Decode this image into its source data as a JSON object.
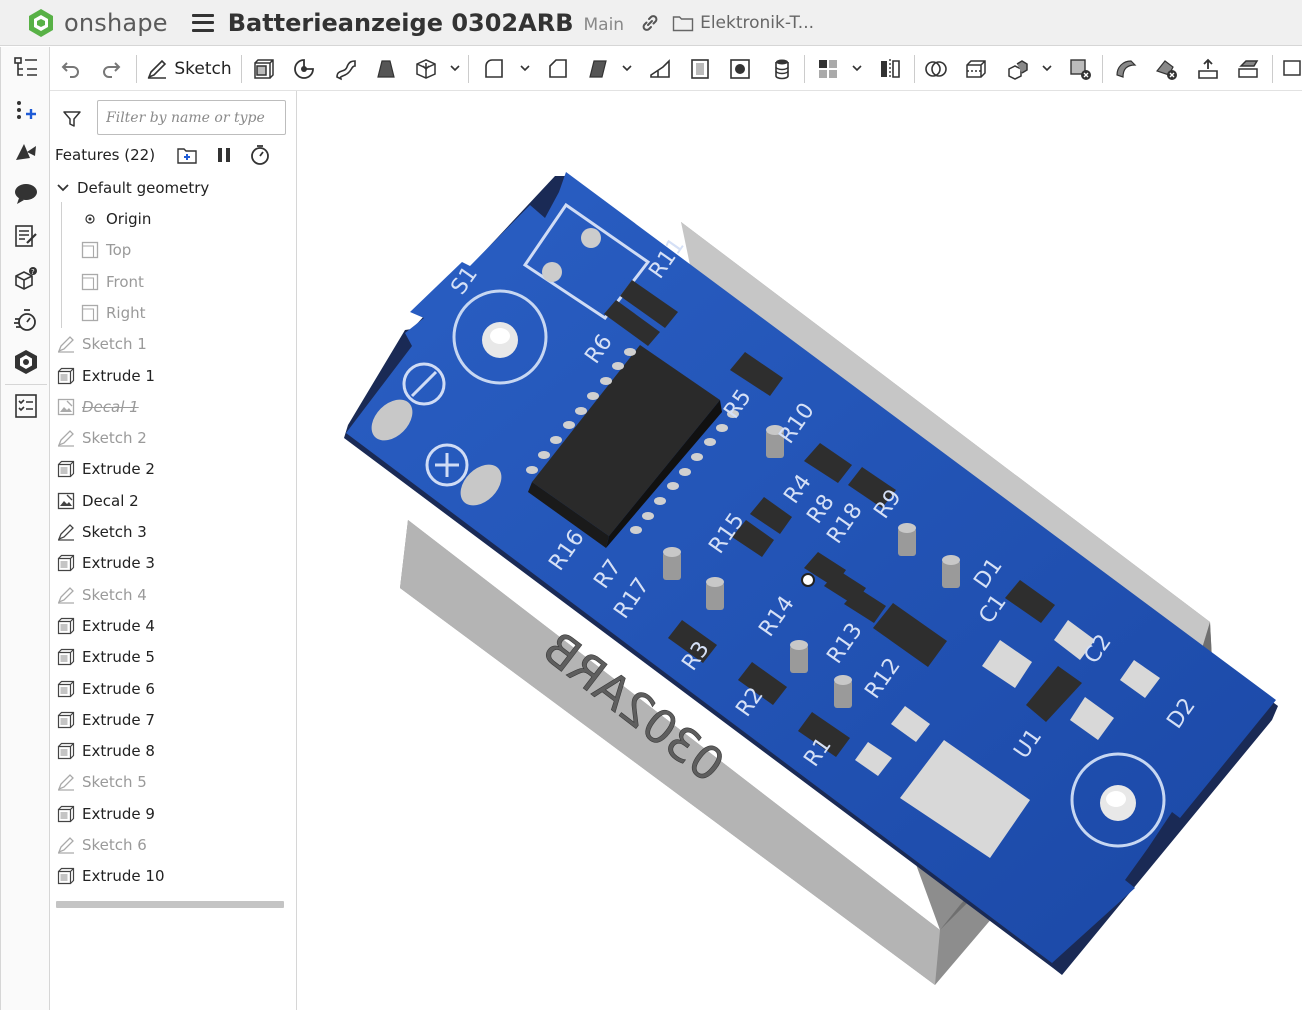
{
  "header": {
    "brand": "onshape",
    "document_title": "Batterieanzeige 0302ARB",
    "branch": "Main",
    "folder_name": "Elektronik-T..."
  },
  "toolbar": {
    "sketch_label": "Sketch"
  },
  "panel": {
    "filter_placeholder": "Filter by name or type",
    "features_title": "Features (22)",
    "default_geometry": "Default geometry",
    "items": [
      {
        "label": "Origin",
        "icon": "origin-icon",
        "state": "normal",
        "indent": 2
      },
      {
        "label": "Top",
        "icon": "plane-icon",
        "state": "dim",
        "indent": 2
      },
      {
        "label": "Front",
        "icon": "plane-icon",
        "state": "dim",
        "indent": 2
      },
      {
        "label": "Right",
        "icon": "plane-icon",
        "state": "dim",
        "indent": 2
      },
      {
        "label": "Sketch 1",
        "icon": "sketch-icon",
        "state": "dim",
        "indent": 1
      },
      {
        "label": "Extrude 1",
        "icon": "extrude-icon",
        "state": "normal",
        "indent": 1
      },
      {
        "label": "Decal 1",
        "icon": "decal-icon",
        "state": "suppressed",
        "indent": 1
      },
      {
        "label": "Sketch 2",
        "icon": "sketch-icon",
        "state": "dim",
        "indent": 1
      },
      {
        "label": "Extrude 2",
        "icon": "extrude-icon",
        "state": "normal",
        "indent": 1
      },
      {
        "label": "Decal 2",
        "icon": "decal-icon",
        "state": "normal",
        "indent": 1
      },
      {
        "label": "Sketch 3",
        "icon": "sketch-icon",
        "state": "normal",
        "indent": 1
      },
      {
        "label": "Extrude 3",
        "icon": "extrude-icon",
        "state": "normal",
        "indent": 1
      },
      {
        "label": "Sketch 4",
        "icon": "sketch-icon",
        "state": "dim",
        "indent": 1
      },
      {
        "label": "Extrude 4",
        "icon": "extrude-icon",
        "state": "normal",
        "indent": 1
      },
      {
        "label": "Extrude 5",
        "icon": "extrude-icon",
        "state": "normal",
        "indent": 1
      },
      {
        "label": "Extrude 6",
        "icon": "extrude-icon",
        "state": "normal",
        "indent": 1
      },
      {
        "label": "Extrude 7",
        "icon": "extrude-icon",
        "state": "normal",
        "indent": 1
      },
      {
        "label": "Extrude 8",
        "icon": "extrude-icon",
        "state": "normal",
        "indent": 1
      },
      {
        "label": "Sketch 5",
        "icon": "sketch-icon",
        "state": "dim",
        "indent": 1
      },
      {
        "label": "Extrude 9",
        "icon": "extrude-icon",
        "state": "normal",
        "indent": 1
      },
      {
        "label": "Sketch 6",
        "icon": "sketch-icon",
        "state": "dim",
        "indent": 1
      },
      {
        "label": "Extrude 10",
        "icon": "extrude-icon",
        "state": "normal",
        "indent": 1
      }
    ]
  },
  "model": {
    "engraving": "0302ARB",
    "silkscreen": [
      "S1",
      "R11",
      "R6",
      "R5",
      "R10",
      "R4",
      "R8",
      "R18",
      "R9",
      "R16",
      "R15",
      "R3",
      "R2",
      "R1",
      "R14",
      "R13",
      "R12",
      "D1",
      "C1",
      "C2",
      "U1",
      "D2",
      "R7",
      "R17",
      "-",
      "+"
    ],
    "pcb_color": "#2050b0",
    "case_color": "#a0a0a0",
    "component_color": "#2e2e2e"
  }
}
